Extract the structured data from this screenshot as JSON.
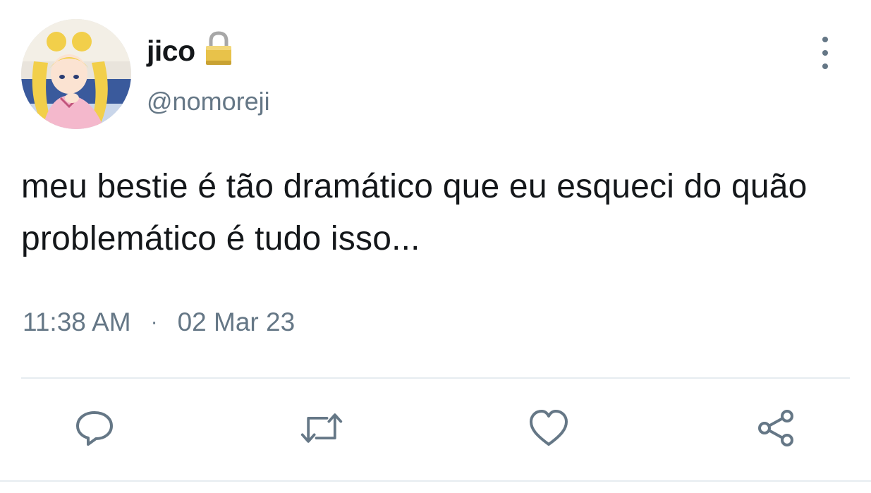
{
  "user": {
    "display_name": "jico",
    "handle": "@nomoreji",
    "protected_icon": "lock-icon",
    "avatar": "anime-avatar"
  },
  "tweet": {
    "text": "meu bestie é tão dramático que eu esqueci do quão problemático é tudo isso...",
    "time": "11:38 AM",
    "separator": "·",
    "date": "02 Mar 23"
  },
  "actions": [
    {
      "name": "reply",
      "icon": "speech-bubble-icon"
    },
    {
      "name": "retweet",
      "icon": "retweet-icon"
    },
    {
      "name": "like",
      "icon": "heart-icon"
    },
    {
      "name": "share",
      "icon": "share-icon"
    }
  ],
  "colors": {
    "text_primary": "#14171a",
    "text_secondary": "#657786",
    "divider": "#e6ecf0",
    "icon": "#657786"
  }
}
